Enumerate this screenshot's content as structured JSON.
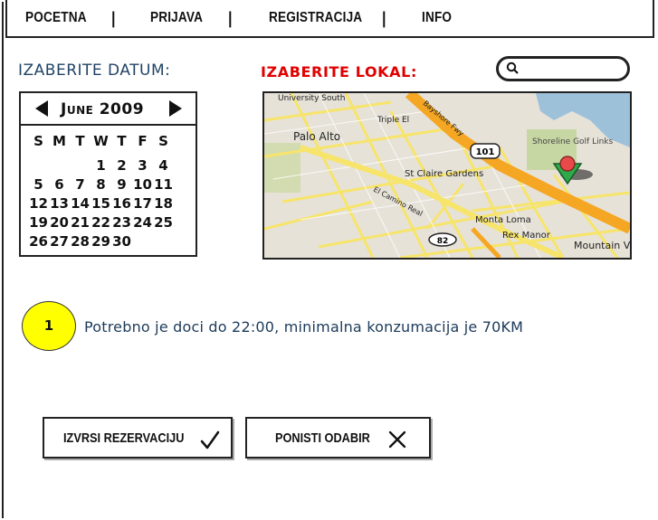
{
  "nav": {
    "items": [
      {
        "label": "POCETNA"
      },
      {
        "label": "PRIJAVA"
      },
      {
        "label": "REGISTRACIJA"
      },
      {
        "label": "INFO"
      }
    ],
    "separator": "|"
  },
  "date_section": {
    "label": "IZABERITE DATUM:"
  },
  "location_section": {
    "label": "IZABERITE LOKAL:"
  },
  "search": {
    "icon": "search-icon",
    "value": ""
  },
  "calendar": {
    "month_title": "June 2009",
    "weekdays": [
      "S",
      "M",
      "T",
      "W",
      "T",
      "F",
      "S"
    ],
    "weeks": [
      [
        "",
        "",
        "",
        "1",
        "2",
        "3",
        "4"
      ],
      [
        "5",
        "6",
        "7",
        "8",
        "9",
        "10",
        "11"
      ],
      [
        "12",
        "13",
        "14",
        "15",
        "16",
        "17",
        "18"
      ],
      [
        "19",
        "20",
        "21",
        "22",
        "23",
        "24",
        "25"
      ],
      [
        "26",
        "27",
        "28",
        "29",
        "30",
        "",
        ""
      ]
    ]
  },
  "map": {
    "labels": [
      "University South",
      "Triple El",
      "Bayshore Fwy",
      "Palo Alto",
      "101",
      "Shoreline Golf Links",
      "St Claire Gardens",
      "El Camino Real",
      "Monta Loma",
      "82",
      "Rex Manor",
      "Mountain View"
    ],
    "marker_icon": "map-pin-icon",
    "colors": {
      "highway": "#f5a623",
      "road": "#f7e46a",
      "park": "#c7d7a4",
      "water": "#9ec1da",
      "land": "#e6e2d8"
    }
  },
  "info": {
    "badge": "1",
    "badge_color": "#ffff00",
    "text": "Potrebno je doci do 22:00, minimalna konzumacija je 70KM"
  },
  "actions": {
    "reserve_label": "IZVRSI REZERVACIJU",
    "reserve_icon": "checkmark-icon",
    "cancel_label": "PONISTI ODABIR",
    "cancel_icon": "x-icon"
  }
}
